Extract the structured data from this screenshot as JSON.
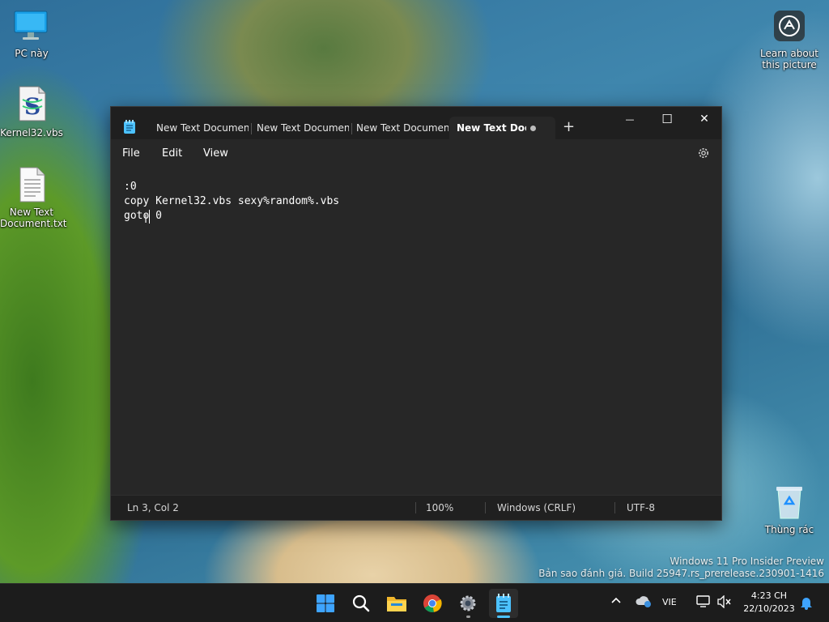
{
  "desktop": {
    "icons": [
      {
        "label": "PC này"
      },
      {
        "label": "Kernel32.vbs"
      },
      {
        "label": "New Text\nDocument.txt"
      },
      {
        "label": "Learn about\nthis picture"
      },
      {
        "label": "Thùng rác"
      }
    ],
    "watermark": {
      "line1": "Windows 11 Pro Insider Preview",
      "line2": "Bản sao đánh giá. Build 25947.rs_prerelease.230901-1416"
    }
  },
  "notepad": {
    "tabs": [
      {
        "label": "New Text Document."
      },
      {
        "label": "New Text Document."
      },
      {
        "label": "New Text Document."
      },
      {
        "label": "New Text Docu",
        "active": true,
        "unsaved": true
      }
    ],
    "new_tab": "+",
    "window_controls": {
      "minimize": "—",
      "maximize": "☐",
      "close": "✕"
    },
    "menu": [
      "File",
      "Edit",
      "View"
    ],
    "content": [
      ":0",
      "copy Kernel32.vbs sexy%random%.vbs",
      "goto 0"
    ],
    "status": {
      "position": "Ln 3, Col 2",
      "zoom": "100%",
      "line_ending": "Windows (CRLF)",
      "encoding": "UTF-8"
    }
  },
  "taskbar": {
    "pinned": [
      "start-icon",
      "search-icon",
      "file-explorer-icon",
      "chrome-icon",
      "settings-icon",
      "notepad-icon"
    ],
    "tray": {
      "language": "VIE",
      "time": "4:23 CH",
      "date": "22/10/2023"
    }
  },
  "colors": {
    "window_bg": "#272727",
    "titlebar_bg": "#1f1f1f",
    "taskbar_bg": "#1c1c1c",
    "accent": "#4cc2ff"
  }
}
